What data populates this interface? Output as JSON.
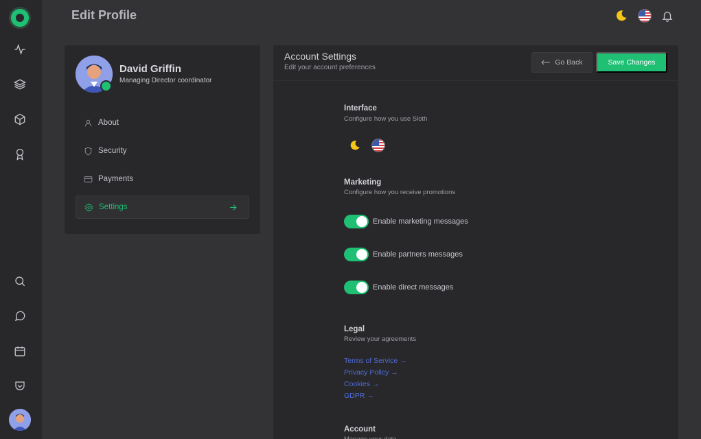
{
  "header": {
    "title": "Edit Profile"
  },
  "profile": {
    "name": "David Griffin",
    "role": "Managing Director coordinator"
  },
  "menu": [
    {
      "label": "About",
      "icon": "user-icon"
    },
    {
      "label": "Security",
      "icon": "shield-icon"
    },
    {
      "label": "Payments",
      "icon": "credit-card-icon"
    },
    {
      "label": "Settings",
      "icon": "gear-icon",
      "active": true
    }
  ],
  "panel": {
    "title": "Account Settings",
    "subtitle": "Edit your account preferences",
    "back_label": "Go Back",
    "save_label": "Save Changes"
  },
  "interface": {
    "title": "Interface",
    "subtitle": "Configure how you use Sloth"
  },
  "marketing": {
    "title": "Marketing",
    "subtitle": "Configure how you receive promotions",
    "toggles": [
      {
        "label": "Enable marketing messages",
        "enabled": true
      },
      {
        "label": "Enable partners messages",
        "enabled": true
      },
      {
        "label": "Enable direct messages",
        "enabled": true
      }
    ]
  },
  "legal": {
    "title": "Legal",
    "subtitle": "Review your agreements",
    "links": [
      "Terms of Service →",
      "Privacy Policy →",
      "Cookies →",
      "GDPR →"
    ]
  },
  "account": {
    "title": "Account",
    "subtitle": "Manage your data"
  },
  "colors": {
    "accent": "#1fbf74",
    "link": "#4f6bd8",
    "moon": "#f5c518"
  }
}
